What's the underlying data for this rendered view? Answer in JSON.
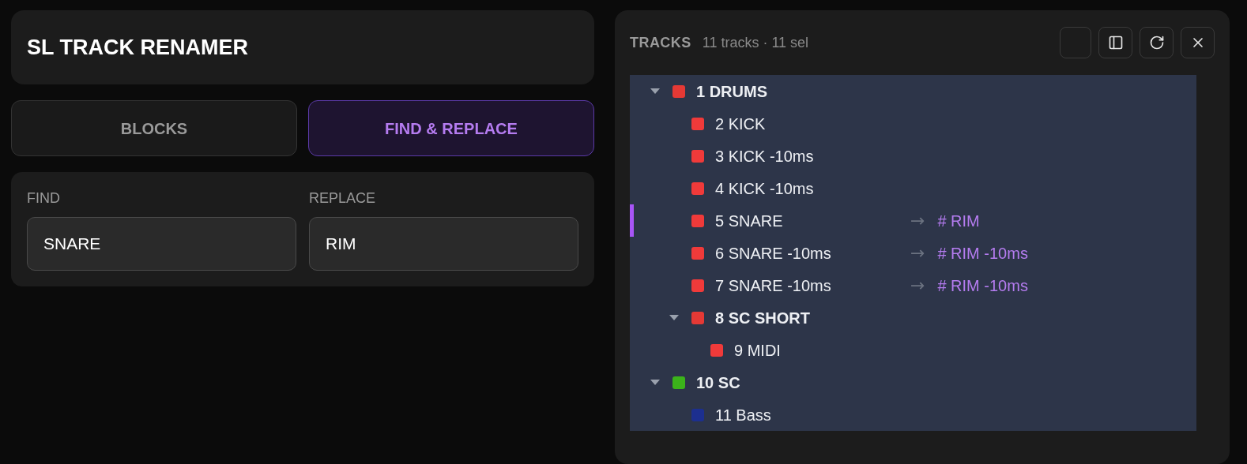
{
  "app_title": "SL TRACK RENAMER",
  "tabs": [
    {
      "label": "BLOCKS",
      "selected": false
    },
    {
      "label": "FIND & REPLACE",
      "selected": true
    }
  ],
  "fields": [
    {
      "label": "FIND",
      "value": "SNARE"
    },
    {
      "label": "REPLACE",
      "value": "RIM"
    }
  ],
  "tracks_panel": {
    "title": "TRACKS",
    "summary": "11 tracks · 11 sel",
    "items": [
      {
        "name": "1 DRUMS",
        "color": "#e53935",
        "selected": true,
        "focused": false,
        "expanded": true,
        "children": [
          {
            "name": "2 KICK",
            "color": "#f03a3a",
            "selected": true,
            "focused": false
          },
          {
            "name": "3 KICK -10ms",
            "color": "#f03a3a",
            "selected": true,
            "focused": false
          },
          {
            "name": "4 KICK -10ms",
            "color": "#f03a3a",
            "selected": true,
            "focused": false
          },
          {
            "name": "5 SNARE",
            "color": "#f03a3a",
            "selected": true,
            "focused": true,
            "arrow": "→",
            "new_name": "# RIM"
          },
          {
            "name": "6 SNARE -10ms",
            "color": "#f03a3a",
            "selected": true,
            "focused": false,
            "arrow": "→",
            "new_name": "# RIM -10ms"
          },
          {
            "name": "7 SNARE -10ms",
            "color": "#f03a3a",
            "selected": true,
            "focused": false,
            "arrow": "→",
            "new_name": "# RIM -10ms"
          },
          {
            "name": "8 SC SHORT",
            "color": "#e53935",
            "selected": true,
            "focused": false,
            "expanded": true,
            "children": [
              {
                "name": "9 MIDI",
                "color": "#f03a3a",
                "selected": true,
                "focused": false
              }
            ]
          }
        ]
      },
      {
        "name": "10 SC",
        "color": "#3bb31a",
        "selected": true,
        "focused": false,
        "expanded": true,
        "children": [
          {
            "name": "11 Bass",
            "color": "#1c2f8f",
            "selected": true,
            "focused": false
          }
        ]
      }
    ]
  }
}
